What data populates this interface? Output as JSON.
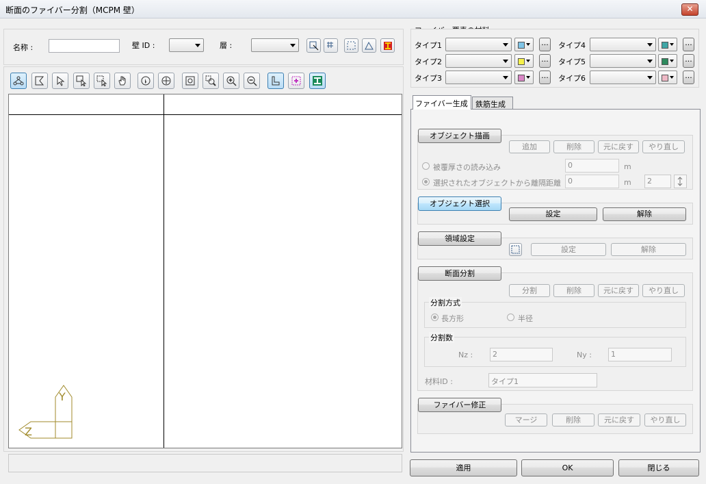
{
  "window": {
    "title": "断面のファイバー分割（MCPM 壁）",
    "close": "✕"
  },
  "top": {
    "name_label": "名称 :",
    "name_value": "",
    "wall_id_label": "壁 ID :",
    "wall_id_value": "",
    "layer_label": "層 :",
    "layer_value": ""
  },
  "materials": {
    "title": "ファイバー要素の材料",
    "types": [
      {
        "label": "タイプ1",
        "value": "",
        "color": "#7fc4e6"
      },
      {
        "label": "タイプ2",
        "value": "",
        "color": "#f5f04a"
      },
      {
        "label": "タイプ3",
        "value": "",
        "color": "#d986c6"
      },
      {
        "label": "タイプ4",
        "value": "",
        "color": "#3fa6a6"
      },
      {
        "label": "タイプ5",
        "value": "",
        "color": "#2e8a5e"
      },
      {
        "label": "タイプ6",
        "value": "",
        "color": "#eeb9c6"
      }
    ],
    "more": "..."
  },
  "tabs": [
    "ファイバー生成",
    "鉄筋生成"
  ],
  "object_draw": {
    "header": "オブジェクト描画",
    "add": "追加",
    "delete": "削除",
    "undo": "元に戻す",
    "redo": "やり直し",
    "cover_label": "被覆厚さの読み込み",
    "cover_value": "0",
    "cover_unit": "m",
    "dist_label": "選択されたオブジェクトから離隔距離",
    "dist_value": "0",
    "dist_unit": "m",
    "count_value": "2"
  },
  "object_select": {
    "header": "オブジェクト選択",
    "set": "設定",
    "release": "解除"
  },
  "region": {
    "header": "領域設定",
    "set": "設定",
    "release": "解除"
  },
  "section_split": {
    "header": "断面分割",
    "split": "分割",
    "delete": "削除",
    "undo": "元に戻す",
    "redo": "やり直し",
    "method_label": "分割方式",
    "rect": "長方形",
    "radius": "半径",
    "count_label": "分割数",
    "nz_label": "Nz :",
    "nz_value": "2",
    "ny_label": "Ny :",
    "ny_value": "1",
    "material_label": "材料ID :",
    "material_value": "タイプ1"
  },
  "fiber_fix": {
    "header": "ファイバー修正",
    "merge": "マージ",
    "delete": "削除",
    "undo": "元に戻す",
    "redo": "やり直し"
  },
  "footer": {
    "apply": "適用",
    "ok": "OK",
    "close": "閉じる"
  },
  "axis": {
    "y": "Y",
    "z": "Z"
  },
  "colors": {
    "axis": "#a08a2a"
  }
}
